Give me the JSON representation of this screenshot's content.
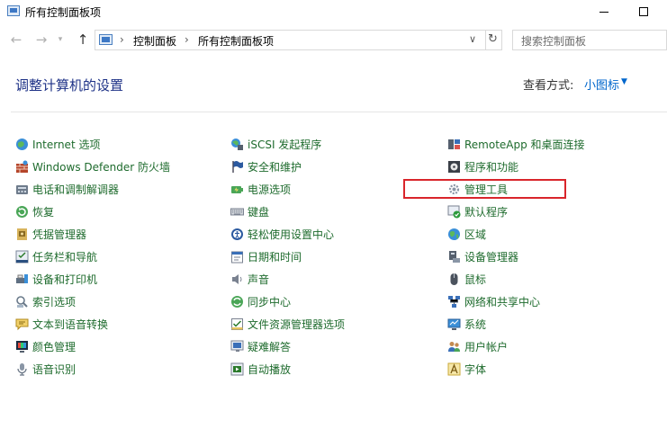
{
  "window": {
    "title": "所有控制面板项"
  },
  "navigation": {
    "back_icon": "arrow-left-icon",
    "forward_icon": "arrow-right-icon",
    "up_icon": "arrow-up-icon"
  },
  "address": {
    "crumbs": [
      "控制面板",
      "所有控制面板项"
    ]
  },
  "search": {
    "placeholder": "搜索控制面板"
  },
  "header": {
    "title": "调整计算机的设置",
    "view_by_label": "查看方式:",
    "view_by_value": "小图标"
  },
  "items": {
    "col1": [
      {
        "label": "Internet 选项",
        "icon": "globe-icon"
      },
      {
        "label": "Windows Defender 防火墙",
        "icon": "firewall-icon"
      },
      {
        "label": "电话和调制解调器",
        "icon": "phone-modem-icon"
      },
      {
        "label": "恢复",
        "icon": "recovery-icon"
      },
      {
        "label": "凭据管理器",
        "icon": "credential-icon"
      },
      {
        "label": "任务栏和导航",
        "icon": "taskbar-icon"
      },
      {
        "label": "设备和打印机",
        "icon": "printer-icon"
      },
      {
        "label": "索引选项",
        "icon": "index-icon"
      },
      {
        "label": "文本到语音转换",
        "icon": "speech-icon"
      },
      {
        "label": "颜色管理",
        "icon": "color-icon"
      },
      {
        "label": "语音识别",
        "icon": "microphone-icon"
      }
    ],
    "col2": [
      {
        "label": "iSCSI 发起程序",
        "icon": "iscsi-icon"
      },
      {
        "label": "安全和维护",
        "icon": "flag-icon"
      },
      {
        "label": "电源选项",
        "icon": "power-icon"
      },
      {
        "label": "键盘",
        "icon": "keyboard-icon"
      },
      {
        "label": "轻松使用设置中心",
        "icon": "ease-access-icon"
      },
      {
        "label": "日期和时间",
        "icon": "calendar-icon"
      },
      {
        "label": "声音",
        "icon": "speaker-icon"
      },
      {
        "label": "同步中心",
        "icon": "sync-icon"
      },
      {
        "label": "文件资源管理器选项",
        "icon": "folder-options-icon"
      },
      {
        "label": "疑难解答",
        "icon": "troubleshoot-icon"
      },
      {
        "label": "自动播放",
        "icon": "autoplay-icon"
      }
    ],
    "col3": [
      {
        "label": "RemoteApp 和桌面连接",
        "icon": "remoteapp-icon"
      },
      {
        "label": "程序和功能",
        "icon": "programs-icon"
      },
      {
        "label": "管理工具",
        "icon": "admin-tools-icon"
      },
      {
        "label": "默认程序",
        "icon": "default-programs-icon"
      },
      {
        "label": "区域",
        "icon": "region-icon"
      },
      {
        "label": "设备管理器",
        "icon": "device-manager-icon"
      },
      {
        "label": "鼠标",
        "icon": "mouse-icon"
      },
      {
        "label": "网络和共享中心",
        "icon": "network-icon"
      },
      {
        "label": "系统",
        "icon": "system-icon"
      },
      {
        "label": "用户帐户",
        "icon": "users-icon"
      },
      {
        "label": "字体",
        "icon": "font-icon"
      }
    ]
  },
  "colors": {
    "link_green": "#1e6b2d",
    "title_blue": "#1e3287",
    "accent_blue": "#0066cc",
    "highlight_red": "#d9252b"
  }
}
